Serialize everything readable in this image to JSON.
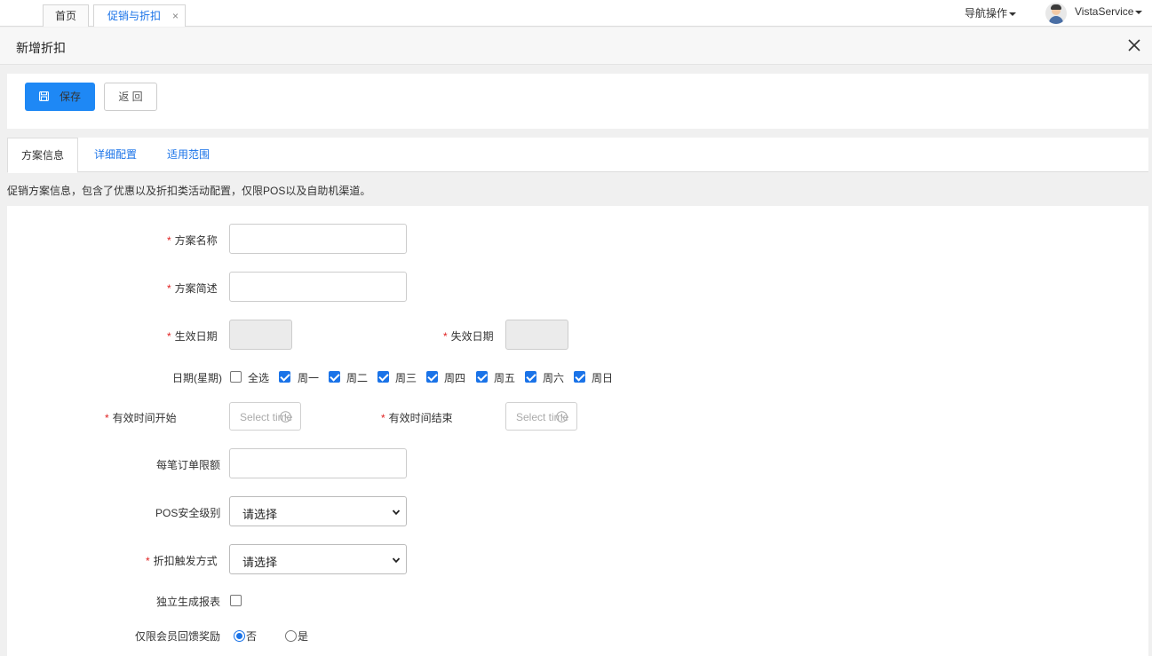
{
  "topbar": {
    "tabs": [
      {
        "label": "首页"
      },
      {
        "label": "促销与折扣"
      }
    ],
    "tab_close": "×",
    "nav_ops": "导航操作",
    "user": "VistaService"
  },
  "header": {
    "title": "新增折扣"
  },
  "toolbar": {
    "save_label": "保存",
    "back_label": "返 回"
  },
  "panel_tabs": [
    {
      "label": "方案信息",
      "active": true
    },
    {
      "label": "详细配置",
      "active": false
    },
    {
      "label": "适用范围",
      "active": false
    }
  ],
  "description": "促销方案信息，包含了优惠以及折扣类活动配置，仅限POS以及自助机渠道。",
  "form": {
    "required_mark": "*",
    "plan_name": {
      "label": "方案名称",
      "value": ""
    },
    "plan_desc": {
      "label": "方案简述",
      "value": ""
    },
    "effective_date": {
      "label": "生效日期"
    },
    "expiry_date": {
      "label": "失效日期"
    },
    "weekdays": {
      "label": "日期(星期)",
      "options": [
        {
          "label": "全选",
          "checked": false
        },
        {
          "label": "周一",
          "checked": true
        },
        {
          "label": "周二",
          "checked": true
        },
        {
          "label": "周三",
          "checked": true
        },
        {
          "label": "周四",
          "checked": true
        },
        {
          "label": "周五",
          "checked": true
        },
        {
          "label": "周六",
          "checked": true
        },
        {
          "label": "周日",
          "checked": true
        }
      ]
    },
    "time_start": {
      "label": "有效时间开始",
      "placeholder": "Select time"
    },
    "time_end": {
      "label": "有效时间结束",
      "placeholder": "Select time"
    },
    "order_limit": {
      "label": "每笔订单限额",
      "value": ""
    },
    "pos_level": {
      "label": "POS安全级别",
      "selected": "请选择"
    },
    "trigger_mode": {
      "label": "折扣触发方式",
      "selected": "请选择"
    },
    "separate_report": {
      "label": "独立生成报表",
      "checked": false
    },
    "member_only": {
      "label": "仅限会员回馈奖励",
      "options": [
        {
          "label": "否",
          "checked": true
        },
        {
          "label": "是",
          "checked": false
        }
      ]
    }
  },
  "colors": {
    "primary": "#1e88f5",
    "link": "#1a73e8",
    "required": "#e02020"
  }
}
